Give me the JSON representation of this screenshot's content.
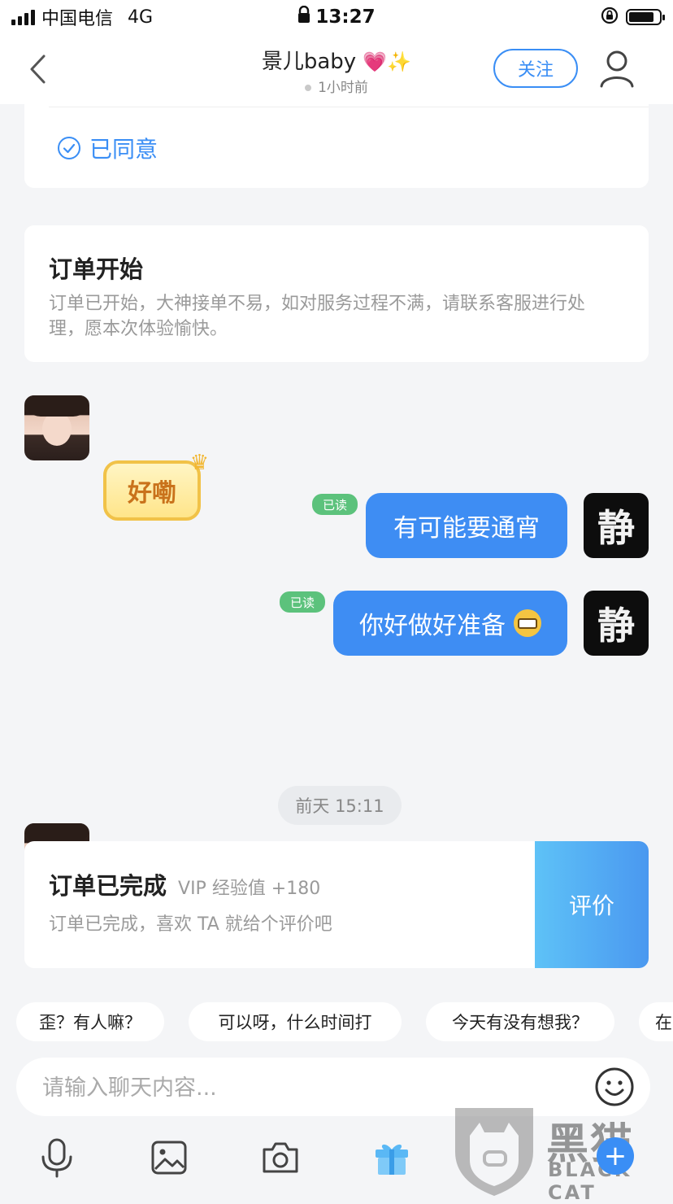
{
  "status_bar": {
    "carrier": "中国电信",
    "network": "4G",
    "time": "13:27"
  },
  "header": {
    "name": "景儿baby",
    "name_emojis": "💗✨",
    "last_seen": "1小时前",
    "follow_label": "关注"
  },
  "agreement": {
    "label": "已同意"
  },
  "order_start": {
    "title": "订单开始",
    "body": "订单已开始，大神接单不易，如对服务过程不满，请联系客服进行处理，愿本次体验愉快。"
  },
  "messages": [
    {
      "from": "other",
      "sticker_text": "好嘞"
    },
    {
      "from": "me",
      "text": "有可能要通宵",
      "status": "已读"
    },
    {
      "from": "me",
      "text": "你好做好准备",
      "status": "已读"
    },
    {
      "from": "other",
      "sticker_text": "好嘞"
    }
  ],
  "avatar_me_glyph": "静",
  "timestamp": "前天 15:11",
  "order_complete": {
    "title": "订单已完成",
    "vip": "VIP 经验值 +180",
    "body": "订单已完成，喜欢 TA 就给个评价吧",
    "rate_label": "评价"
  },
  "quick_replies": [
    "歪？有人嘛？",
    "可以呀，什么时间打",
    "今天有没有想我？",
    "在"
  ],
  "composer": {
    "placeholder": "请输入聊天内容..."
  },
  "toolbar": [
    "microphone-icon",
    "image-icon",
    "camera-icon",
    "gift-icon",
    "gamepad-icon",
    "plus-icon"
  ],
  "watermark": {
    "brand": "黑猫",
    "brand_en": "BLACK CAT"
  },
  "colors": {
    "accent": "#3e8df3",
    "read_badge": "#5cc27c",
    "background": "#f4f5f7"
  }
}
